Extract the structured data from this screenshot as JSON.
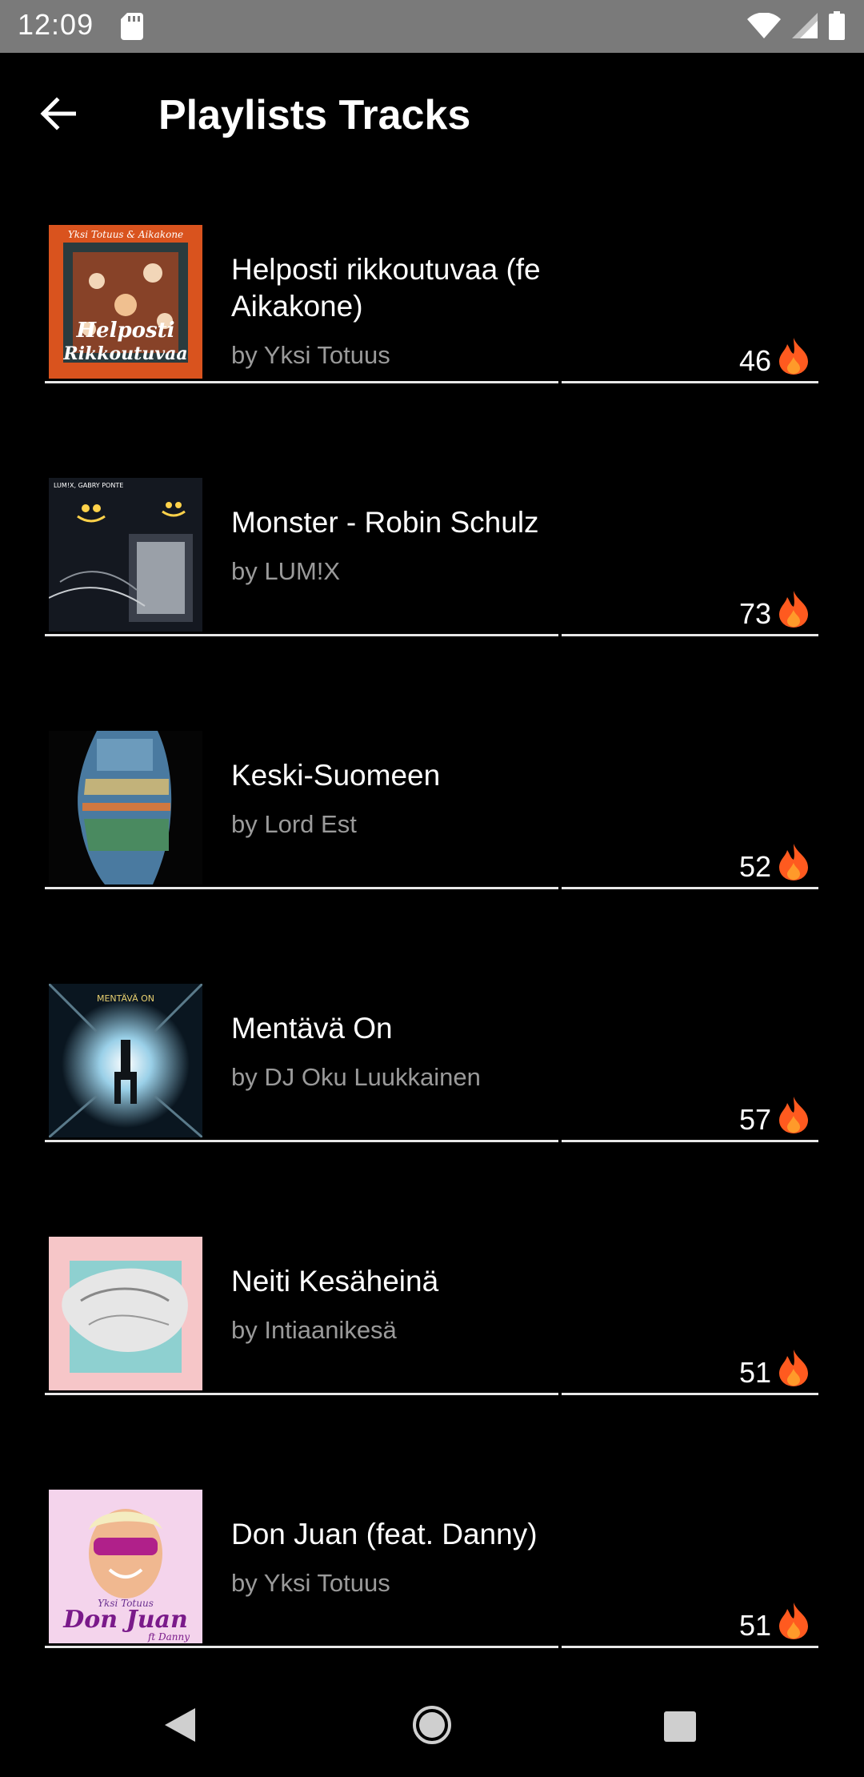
{
  "status_bar": {
    "time": "12:09",
    "icons": [
      "sd-card-icon",
      "wifi-icon",
      "signal-icon",
      "battery-icon"
    ]
  },
  "toolbar": {
    "back_icon": "arrow-left-icon",
    "title": "Playlists Tracks"
  },
  "tracks": [
    {
      "title": "Helposti rikkoutuvaa (fe Aikakone)",
      "artist": "by Yksi Totuus",
      "score": "46",
      "cover": "helposti-rikkoutuvaa"
    },
    {
      "title": "Monster - Robin Schulz",
      "artist": "by LUM!X",
      "score": "73",
      "cover": "monster"
    },
    {
      "title": "Keski-Suomeen",
      "artist": "by Lord Est",
      "score": "52",
      "cover": "keski-suomeen"
    },
    {
      "title": "Mentävä On",
      "artist": "by DJ Oku Luukkainen",
      "score": "57",
      "cover": "mentava-on"
    },
    {
      "title": "Neiti Kesäheinä",
      "artist": "by Intiaanikesä",
      "score": "51",
      "cover": "neiti-kesaheina"
    },
    {
      "title": "Don Juan (feat. Danny)",
      "artist": "by Yksi Totuus",
      "score": "51",
      "cover": "don-juan"
    }
  ],
  "cover_text": {
    "helposti_top": "Yksi Totuus & Aikakone",
    "helposti_main_1": "Helposti",
    "helposti_main_2": "Rikkoutuvaa",
    "monster_top": "LUM!X, GABRY PONTE",
    "mentava_top": "MENTÄVÄ ON",
    "donjuan_top": "Yksi Totuus",
    "donjuan_main": "Don Juan",
    "donjuan_sub": "ft Danny"
  },
  "colors": {
    "background": "#000000",
    "status_bar": "#7a7a7a",
    "artist_text": "#9a9a9a",
    "flame_outer": "#ff5a1f",
    "flame_inner": "#ff9a2a"
  },
  "nav_bar": {
    "icons": [
      "nav-back-icon",
      "nav-home-icon",
      "nav-recents-icon"
    ]
  }
}
